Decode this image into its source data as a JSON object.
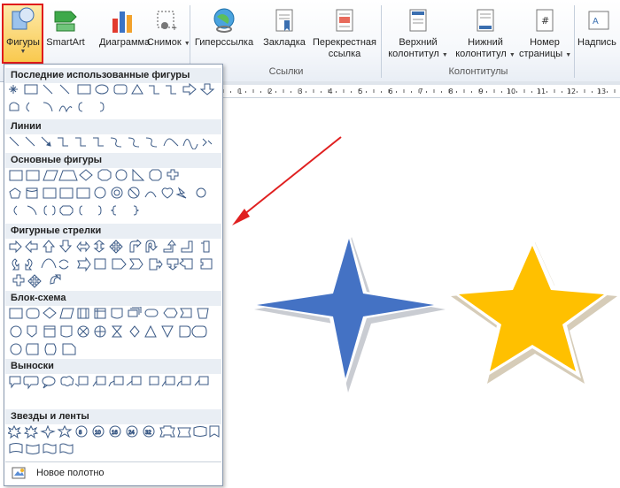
{
  "ribbon": {
    "buttons": [
      {
        "id": "shapes",
        "label": "Фигуры",
        "icon": "shapes-icon"
      },
      {
        "id": "smartart",
        "label": "SmartArt",
        "icon": "smartart-icon"
      },
      {
        "id": "chart",
        "label": "Диаграмма",
        "icon": "chart-icon"
      },
      {
        "id": "screenshot",
        "label": "Снимок",
        "icon": "screenshot-icon"
      },
      {
        "id": "hyperlink",
        "label": "Гиперссылка",
        "icon": "hyperlink-icon"
      },
      {
        "id": "bookmark",
        "label": "Закладка",
        "icon": "bookmark-icon"
      },
      {
        "id": "crossref",
        "label": "Перекрестная",
        "label2": "ссылка",
        "icon": "cross-reference-icon"
      },
      {
        "id": "header",
        "label": "Верхний",
        "label2": "колонтитул",
        "icon": "header-icon"
      },
      {
        "id": "footer",
        "label": "Нижний",
        "label2": "колонтитул",
        "icon": "footer-icon"
      },
      {
        "id": "pagenum",
        "label": "Номер",
        "label2": "страницы",
        "icon": "page-number-icon"
      },
      {
        "id": "textbox",
        "label": "Надпись",
        "icon": "textbox-icon"
      }
    ],
    "groups": {
      "links": "Ссылки",
      "headers": "Колонтитулы"
    }
  },
  "ruler": {
    "ticks": [
      "1",
      "2",
      "3",
      "4",
      "5",
      "6",
      "7",
      "8",
      "9",
      "10",
      "11",
      "12",
      "13"
    ]
  },
  "shapes_panel": {
    "sections": [
      {
        "title": "Последние использованные фигуры"
      },
      {
        "title": "Линии"
      },
      {
        "title": "Основные фигуры"
      },
      {
        "title": "Фигурные стрелки"
      },
      {
        "title": "Блок-схема"
      },
      {
        "title": "Выноски"
      },
      {
        "title": "Звезды и ленты"
      }
    ],
    "footer_label": "Новое полотно"
  },
  "colors": {
    "star4": "#4472c4",
    "star5": "#ffc000",
    "arrow": "#e02020",
    "highlight": "#e01b1b"
  }
}
